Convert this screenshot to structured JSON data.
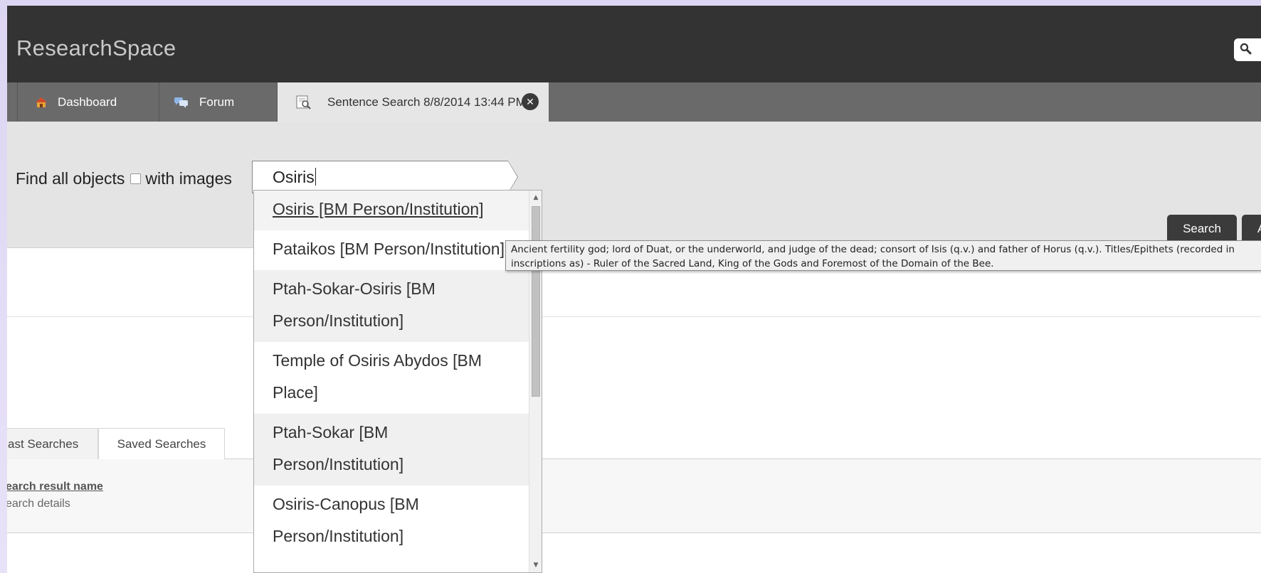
{
  "app": {
    "title": "ResearchSpace"
  },
  "tabs": {
    "dashboard": "Dashboard",
    "forum": "Forum",
    "active": "Sentence Search 8/8/2014 13:44 PM",
    "close_glyph": "✕"
  },
  "search": {
    "label_before": "Find all objects",
    "label_after": "with images",
    "query": "Osiris",
    "search_button": "Search",
    "advanced_button": "A"
  },
  "autocomplete": {
    "items": [
      "Osiris [BM Person/Institution]",
      "Pataikos [BM Person/Institution]",
      "Ptah-Sokar-Osiris [BM Person/Institution]",
      "Temple of Osiris Abydos [BM Place]",
      "Ptah-Sokar [BM Person/Institution]",
      "Osiris-Canopus [BM Person/Institution]"
    ],
    "tooltip": "Ancient fertility god; lord of Duat, or the underworld, and judge of the dead; consort of Isis (q.v.) and father of Horus (q.v.).  Titles/Epithets (recorded in inscriptions as) -  Ruler of the Sacred Land, King of the Gods and Foremost of the Domain of the Bee."
  },
  "bottom": {
    "tab_past": "ast Searches",
    "tab_saved": "Saved Searches",
    "result_name": "earch result name",
    "result_details": "earch details"
  },
  "icons": {
    "search": "search-icon",
    "dashboard": "home-icon",
    "forum": "forum-icon",
    "sentence": "sentence-search-icon",
    "close": "close-icon"
  },
  "colors": {
    "topbar": "#333333",
    "tabbar": "#6a6a6a",
    "panel": "#e4e4e4",
    "button": "#3b3b3b"
  }
}
